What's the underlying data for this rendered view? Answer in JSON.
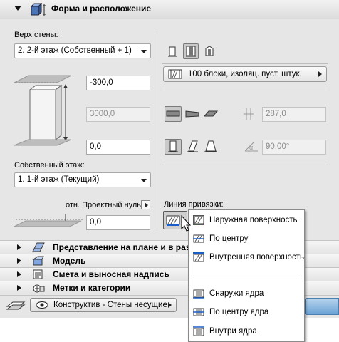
{
  "header": {
    "title": "Форма и расположение",
    "icon": "wall-box-icon"
  },
  "top_wall": {
    "label": "Верх стены:",
    "value": "2. 2-й этаж (Собственный + 1)",
    "offset": "-300,0"
  },
  "height": "3000,0",
  "base_offset": "0,0",
  "home_story": {
    "label": "Собственный этаж:",
    "value": "1. 1-й этаж (Текущий)"
  },
  "reference": {
    "label": "отн. Проектный нуль",
    "value": "0,0"
  },
  "profile": {
    "label": "100 блоки, изоляц. пуст. штук."
  },
  "thickness": "287,0",
  "angle": "90,00°",
  "ref_line": {
    "label": "Линия привязки:"
  },
  "sections": [
    {
      "label": "Представление на плане и в раз",
      "icon": "plan-section-icon"
    },
    {
      "label": "Модель",
      "icon": "model-icon"
    },
    {
      "label": "Смета и выносная надпись",
      "icon": "listing-icon"
    },
    {
      "label": "Метки и категории",
      "icon": "tags-icon"
    }
  ],
  "layer": {
    "label": "Конструктив - Стены несущие",
    "icon": "eye-icon"
  },
  "menu": {
    "items": [
      {
        "label": "Наружная поверхность",
        "icon": "ref-outside-icon",
        "selected": true
      },
      {
        "label": "По центру",
        "icon": "ref-center-icon",
        "selected": false
      },
      {
        "label": "Внутренняя поверхность",
        "icon": "ref-inside-icon",
        "selected": false
      },
      {
        "label": "Снаружи ядра",
        "icon": "core-outside-icon",
        "selected": false
      },
      {
        "label": "По центру ядра",
        "icon": "core-center-icon",
        "selected": false
      },
      {
        "label": "Внутри ядра",
        "icon": "core-inside-icon",
        "selected": false
      }
    ]
  },
  "colors": {
    "accent": "#6aa3d6",
    "selected": "#c9c9c9"
  }
}
